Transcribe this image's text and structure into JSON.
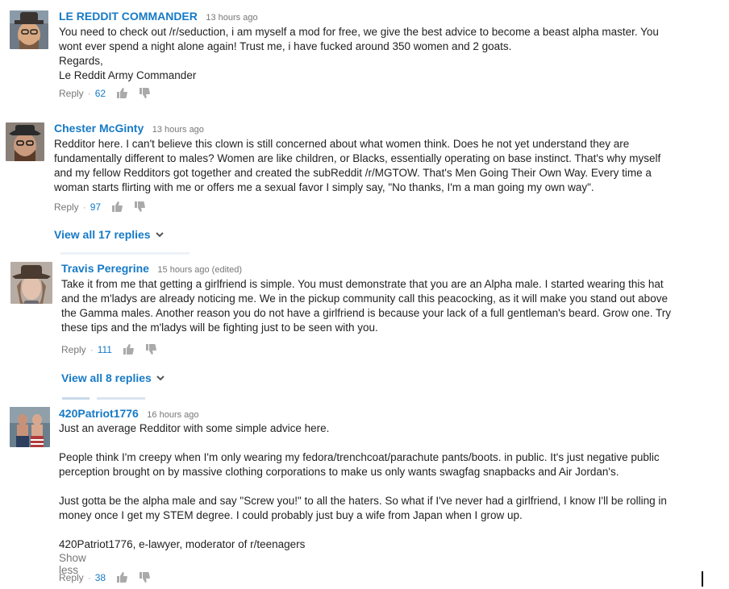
{
  "comments": [
    {
      "author": "LE REDDIT COMMANDER",
      "time": "13 hours ago",
      "lines": [
        "You need to check out /r/seduction, i am myself a mod for free, we give the best advice to become a beast alpha master. You",
        "wont ever spend a night alone again! Trust me, i have fucked around 350 women and 2 goats.",
        "Regards,",
        "Le Reddit Army Commander"
      ],
      "reply_label": "Reply",
      "likes": "62",
      "avatar_colors": {
        "bg": "#6e7a86",
        "skin": "#d8a882",
        "hat": "#3a3330"
      }
    },
    {
      "author": "Chester McGinty",
      "time": "13 hours ago",
      "lines": [
        "Redditor here. I can't believe this clown is still concerned about what women think. Does he not yet understand they are",
        "fundamentally different to males? Women are like children, or Blacks, essentially operating on base instinct. That's why myself",
        "and my fellow Redditors got together and created the subReddit /r/MGTOW. That's Men Going Their Own Way. Every time a",
        "woman starts flirting with me or offers me a sexual favor I simply say, \"No thanks, I'm a man going my own way\"."
      ],
      "reply_label": "Reply",
      "likes": "97",
      "view_replies": "View all 17 replies",
      "avatar_colors": {
        "bg": "#8a8078",
        "skin": "#c99a7e",
        "hat": "#2b2b2b"
      }
    },
    {
      "author": "Travis Peregrine",
      "time": "15 hours ago (edited)",
      "lines": [
        "Take it from me that getting a girlfriend is simple.  You must demonstrate that you are an Alpha male.  I started wearing this hat",
        "and the m'ladys are already noticing me.  We in the pickup community call this peacocking, as it will make you stand out above",
        "the Gamma males.  Another reason you do not have a girlfriend is because your lack of a full gentleman's beard.  Grow one.  Try",
        "these tips and the m'ladys will be fighting just to be seen with you."
      ],
      "reply_label": "Reply",
      "likes": "111",
      "view_replies": "View all 8 replies",
      "avatar_colors": {
        "bg": "#b7aca3",
        "skin": "#e2c2ae",
        "hat": "#4a3a30"
      }
    },
    {
      "author": "420Patriot1776",
      "time": "16 hours ago",
      "paragraphs": [
        [
          "Just an average Redditor with some simple advice here."
        ],
        [
          "People think I'm creepy when I'm only wearing my fedora/trenchcoat/parachute pants/boots. in public. It's just negative public",
          "perception brought on by massive clothing corporations to make us only wants swagfag snapbacks and Air Jordan's."
        ],
        [
          "Just gotta be the alpha male and say \"Screw you!\" to all the haters. So what if I've never had a girlfriend, I know I'll be rolling in",
          "money once I get my STEM degree. I could probably just buy a wife from Japan when I grow up."
        ],
        [
          "420Patriot1776, e-lawyer, moderator of r/teenagers"
        ]
      ],
      "show_less": "Show less",
      "reply_label": "Reply",
      "likes": "38",
      "avatar_colors": {
        "bg": "#6a7f8e",
        "skin": "#c8927a",
        "hat": "#2e3e5e"
      }
    }
  ],
  "colors": {
    "link": "#167ac6",
    "meta": "#777777",
    "text": "#222222"
  },
  "icons": [
    "thumbs-up-icon",
    "thumbs-down-icon",
    "chevron-down-icon"
  ]
}
